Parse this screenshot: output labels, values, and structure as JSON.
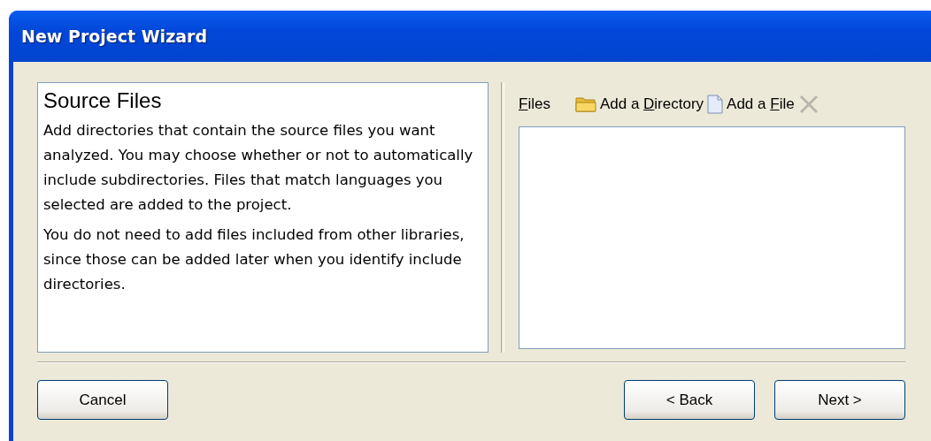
{
  "window": {
    "title": "New Project Wizard"
  },
  "info": {
    "heading": "Source Files",
    "paragraphs": [
      "Add directories that contain the source files you want analyzed. You may choose whether or not to automatically include subdirectories. Files that match languages you selected are added to the project.",
      "You do not need to add files included from other libraries, since those can be added later when you identify include directories."
    ]
  },
  "files": {
    "label": {
      "key": "F",
      "after": "iles"
    },
    "actions": [
      {
        "kind": "folder",
        "before": "Add a ",
        "key": "D",
        "after": "irectory",
        "disabled": false
      },
      {
        "kind": "file",
        "before": "Add a ",
        "key": "F",
        "after": "ile",
        "disabled": false
      },
      {
        "kind": "remove",
        "disabled": true
      }
    ]
  },
  "buttons": [
    {
      "label": "Cancel",
      "kind": "left"
    },
    {
      "label": "< Back",
      "kind": "right"
    },
    {
      "label": "Next >",
      "kind": "right"
    }
  ]
}
